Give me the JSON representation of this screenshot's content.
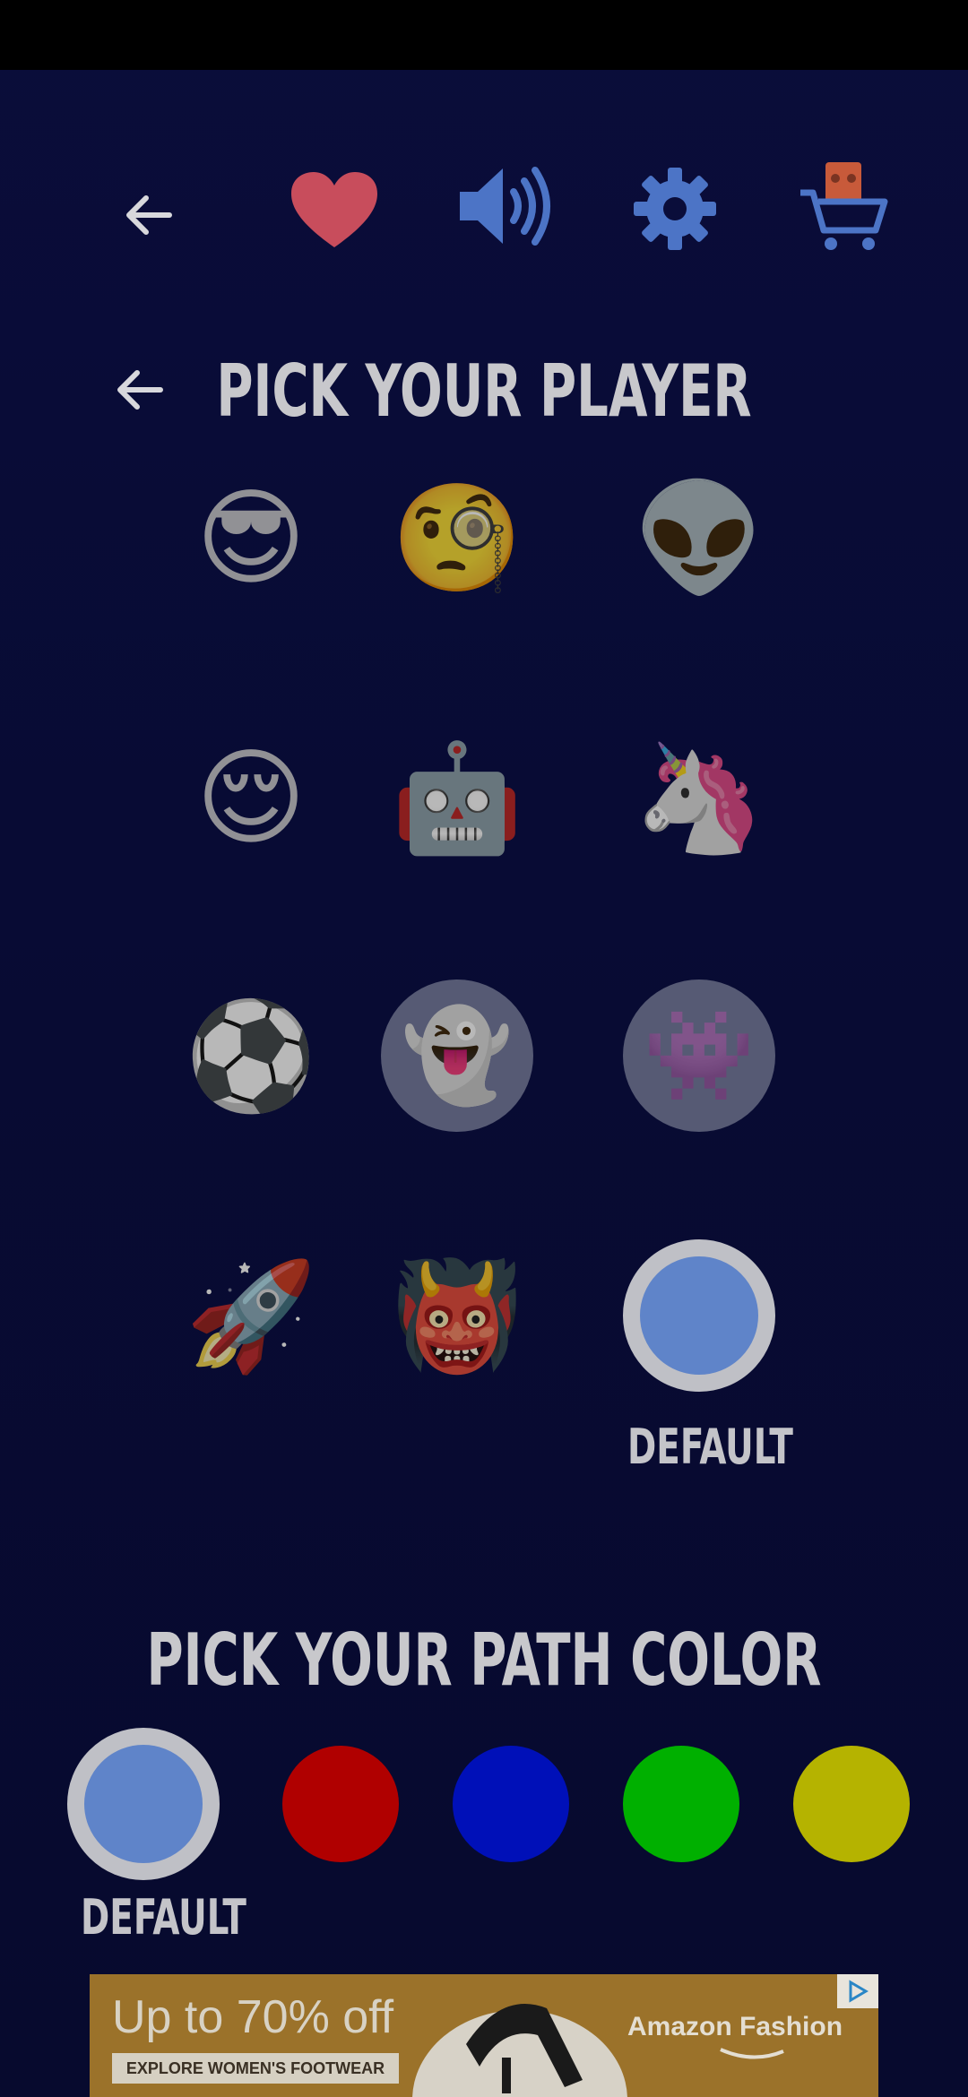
{
  "topbar": {
    "icons": [
      "back-arrow-icon",
      "heart-icon",
      "speaker-icon",
      "gear-icon",
      "shop-cart-icon"
    ],
    "colors": {
      "heart": "#c84d5c",
      "speaker": "#4c74c6",
      "gear": "#4c74c6",
      "cart": "#4c74c6",
      "cart_item": "#c85a3a"
    }
  },
  "player_section": {
    "title": "PICK YOUR PLAYER",
    "players": [
      {
        "name": "sunglasses-face",
        "glyph": "😎"
      },
      {
        "name": "monocle-face",
        "glyph": "🧐"
      },
      {
        "name": "alien",
        "glyph": "👽"
      },
      {
        "name": "relieved-face",
        "glyph": "😌"
      },
      {
        "name": "robot",
        "glyph": "🤖"
      },
      {
        "name": "unicorn",
        "glyph": "🦄"
      },
      {
        "name": "soccer-ball",
        "glyph": "⚽"
      },
      {
        "name": "ghost",
        "glyph": "👻"
      },
      {
        "name": "space-invader",
        "glyph": "👾"
      },
      {
        "name": "rocket",
        "glyph": "🚀"
      },
      {
        "name": "ogre",
        "glyph": "👹"
      },
      {
        "name": "default",
        "glyph": ""
      }
    ],
    "default_label": "DEFAULT"
  },
  "path_section": {
    "title": "PICK YOUR PATH COLOR",
    "default_label": "DEFAULT",
    "colors": [
      "#5f84c9",
      "#b00000",
      "#0010b8",
      "#00b000",
      "#b5b300"
    ]
  },
  "ad": {
    "headline": "Up to 70% off",
    "cta": "EXPLORE WOMEN'S FOOTWEAR",
    "brand": "Amazon Fashion",
    "background": "#9b722a"
  }
}
